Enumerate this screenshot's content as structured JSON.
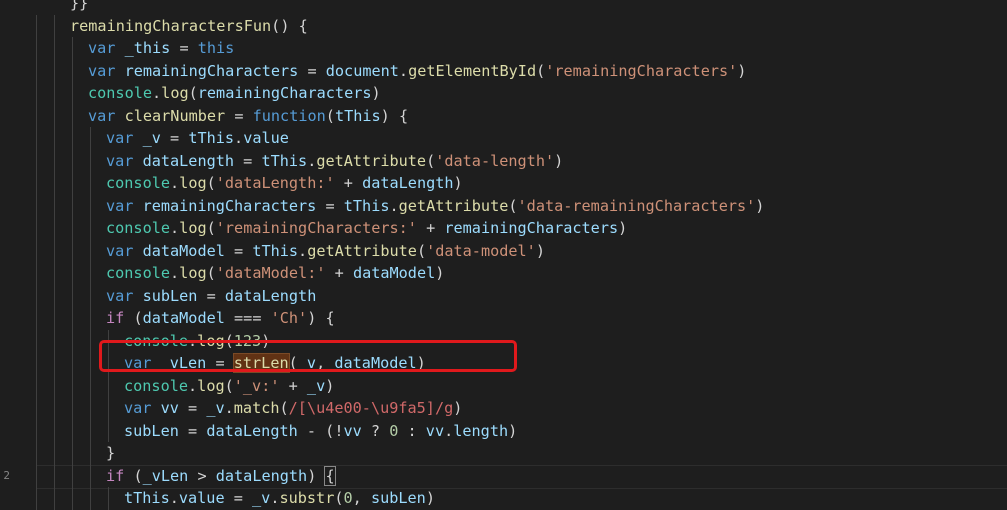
{
  "editor": {
    "line_numbers": [
      "",
      "",
      "",
      "",
      "",
      "",
      "",
      "",
      "",
      "",
      "",
      "",
      "",
      "",
      "",
      "",
      "",
      "",
      "",
      "",
      "",
      "2",
      ""
    ],
    "code_lines": [
      [
        {
          "t": "}}",
          "c": "pl"
        }
      ],
      [
        {
          "t": "remainingCharactersFun",
          "c": "fn"
        },
        {
          "t": "() {",
          "c": "pl"
        }
      ],
      [
        {
          "t": "var",
          "c": "kw"
        },
        {
          "t": " ",
          "c": "pl"
        },
        {
          "t": "_this",
          "c": "var"
        },
        {
          "t": " = ",
          "c": "pl"
        },
        {
          "t": "this",
          "c": "kw"
        }
      ],
      [
        {
          "t": "var",
          "c": "kw"
        },
        {
          "t": " ",
          "c": "pl"
        },
        {
          "t": "remainingCharacters",
          "c": "var"
        },
        {
          "t": " = ",
          "c": "pl"
        },
        {
          "t": "document",
          "c": "var"
        },
        {
          "t": ".",
          "c": "pl"
        },
        {
          "t": "getElementById",
          "c": "fn"
        },
        {
          "t": "(",
          "c": "pl"
        },
        {
          "t": "'remainingCharacters'",
          "c": "str"
        },
        {
          "t": ")",
          "c": "pl"
        }
      ],
      [
        {
          "t": "console",
          "c": "cls"
        },
        {
          "t": ".",
          "c": "pl"
        },
        {
          "t": "log",
          "c": "fn"
        },
        {
          "t": "(",
          "c": "pl"
        },
        {
          "t": "remainingCharacters",
          "c": "var"
        },
        {
          "t": ")",
          "c": "pl"
        }
      ],
      [
        {
          "t": "var",
          "c": "kw"
        },
        {
          "t": " ",
          "c": "pl"
        },
        {
          "t": "clearNumber",
          "c": "fn"
        },
        {
          "t": " = ",
          "c": "pl"
        },
        {
          "t": "function",
          "c": "kw"
        },
        {
          "t": "(",
          "c": "pl"
        },
        {
          "t": "tThis",
          "c": "var"
        },
        {
          "t": ") {",
          "c": "pl"
        }
      ],
      [
        {
          "t": "var",
          "c": "kw"
        },
        {
          "t": " ",
          "c": "pl"
        },
        {
          "t": "_v",
          "c": "var"
        },
        {
          "t": " = ",
          "c": "pl"
        },
        {
          "t": "tThis",
          "c": "var"
        },
        {
          "t": ".",
          "c": "pl"
        },
        {
          "t": "value",
          "c": "var"
        }
      ],
      [
        {
          "t": "var",
          "c": "kw"
        },
        {
          "t": " ",
          "c": "pl"
        },
        {
          "t": "dataLength",
          "c": "var"
        },
        {
          "t": " = ",
          "c": "pl"
        },
        {
          "t": "tThis",
          "c": "var"
        },
        {
          "t": ".",
          "c": "pl"
        },
        {
          "t": "getAttribute",
          "c": "fn"
        },
        {
          "t": "(",
          "c": "pl"
        },
        {
          "t": "'data-length'",
          "c": "str"
        },
        {
          "t": ")",
          "c": "pl"
        }
      ],
      [
        {
          "t": "console",
          "c": "cls"
        },
        {
          "t": ".",
          "c": "pl"
        },
        {
          "t": "log",
          "c": "fn"
        },
        {
          "t": "(",
          "c": "pl"
        },
        {
          "t": "'dataLength:'",
          "c": "str"
        },
        {
          "t": " + ",
          "c": "pl"
        },
        {
          "t": "dataLength",
          "c": "var"
        },
        {
          "t": ")",
          "c": "pl"
        }
      ],
      [
        {
          "t": "var",
          "c": "kw"
        },
        {
          "t": " ",
          "c": "pl"
        },
        {
          "t": "remainingCharacters",
          "c": "var"
        },
        {
          "t": " = ",
          "c": "pl"
        },
        {
          "t": "tThis",
          "c": "var"
        },
        {
          "t": ".",
          "c": "pl"
        },
        {
          "t": "getAttribute",
          "c": "fn"
        },
        {
          "t": "(",
          "c": "pl"
        },
        {
          "t": "'data-remainingCharacters'",
          "c": "str"
        },
        {
          "t": ")",
          "c": "pl"
        }
      ],
      [
        {
          "t": "console",
          "c": "cls"
        },
        {
          "t": ".",
          "c": "pl"
        },
        {
          "t": "log",
          "c": "fn"
        },
        {
          "t": "(",
          "c": "pl"
        },
        {
          "t": "'remainingCharacters:'",
          "c": "str"
        },
        {
          "t": " + ",
          "c": "pl"
        },
        {
          "t": "remainingCharacters",
          "c": "var"
        },
        {
          "t": ")",
          "c": "pl"
        }
      ],
      [
        {
          "t": "var",
          "c": "kw"
        },
        {
          "t": " ",
          "c": "pl"
        },
        {
          "t": "dataModel",
          "c": "var"
        },
        {
          "t": " = ",
          "c": "pl"
        },
        {
          "t": "tThis",
          "c": "var"
        },
        {
          "t": ".",
          "c": "pl"
        },
        {
          "t": "getAttribute",
          "c": "fn"
        },
        {
          "t": "(",
          "c": "pl"
        },
        {
          "t": "'data-model'",
          "c": "str"
        },
        {
          "t": ")",
          "c": "pl"
        }
      ],
      [
        {
          "t": "console",
          "c": "cls"
        },
        {
          "t": ".",
          "c": "pl"
        },
        {
          "t": "log",
          "c": "fn"
        },
        {
          "t": "(",
          "c": "pl"
        },
        {
          "t": "'dataModel:'",
          "c": "str"
        },
        {
          "t": " + ",
          "c": "pl"
        },
        {
          "t": "dataModel",
          "c": "var"
        },
        {
          "t": ")",
          "c": "pl"
        }
      ],
      [
        {
          "t": "var",
          "c": "kw"
        },
        {
          "t": " ",
          "c": "pl"
        },
        {
          "t": "subLen",
          "c": "var"
        },
        {
          "t": " = ",
          "c": "pl"
        },
        {
          "t": "dataLength",
          "c": "var"
        }
      ],
      [
        {
          "t": "if",
          "c": "kwc"
        },
        {
          "t": " (",
          "c": "pl"
        },
        {
          "t": "dataModel",
          "c": "var"
        },
        {
          "t": " === ",
          "c": "pl"
        },
        {
          "t": "'Ch'",
          "c": "str"
        },
        {
          "t": ") {",
          "c": "pl"
        }
      ],
      [
        {
          "t": "console",
          "c": "cls"
        },
        {
          "t": ".",
          "c": "pl"
        },
        {
          "t": "log",
          "c": "fn"
        },
        {
          "t": "(",
          "c": "pl"
        },
        {
          "t": "123",
          "c": "num"
        },
        {
          "t": ")",
          "c": "pl"
        }
      ],
      [
        {
          "t": "var",
          "c": "kw"
        },
        {
          "t": " ",
          "c": "pl"
        },
        {
          "t": "_vLen",
          "c": "var"
        },
        {
          "t": " = ",
          "c": "pl"
        },
        {
          "t": "strLen",
          "c": "fnhl"
        },
        {
          "t": "(",
          "c": "pl"
        },
        {
          "t": "_v",
          "c": "var"
        },
        {
          "t": ", ",
          "c": "pl"
        },
        {
          "t": "dataModel",
          "c": "var"
        },
        {
          "t": ")",
          "c": "pl"
        }
      ],
      [
        {
          "t": "console",
          "c": "cls"
        },
        {
          "t": ".",
          "c": "pl"
        },
        {
          "t": "log",
          "c": "fn"
        },
        {
          "t": "(",
          "c": "pl"
        },
        {
          "t": "'_v:'",
          "c": "str"
        },
        {
          "t": " + ",
          "c": "pl"
        },
        {
          "t": "_v",
          "c": "var"
        },
        {
          "t": ")",
          "c": "pl"
        }
      ],
      [
        {
          "t": "var",
          "c": "kw"
        },
        {
          "t": " ",
          "c": "pl"
        },
        {
          "t": "vv",
          "c": "var"
        },
        {
          "t": " = ",
          "c": "pl"
        },
        {
          "t": "_v",
          "c": "var"
        },
        {
          "t": ".",
          "c": "pl"
        },
        {
          "t": "match",
          "c": "fn"
        },
        {
          "t": "(",
          "c": "pl"
        },
        {
          "t": "/[\\u4e00-\\u9fa5]/g",
          "c": "rx"
        },
        {
          "t": ")",
          "c": "pl"
        }
      ],
      [
        {
          "t": "subLen",
          "c": "var"
        },
        {
          "t": " = ",
          "c": "pl"
        },
        {
          "t": "dataLength",
          "c": "var"
        },
        {
          "t": " - (!",
          "c": "pl"
        },
        {
          "t": "vv",
          "c": "var"
        },
        {
          "t": " ? ",
          "c": "pl"
        },
        {
          "t": "0",
          "c": "num"
        },
        {
          "t": " : ",
          "c": "pl"
        },
        {
          "t": "vv",
          "c": "var"
        },
        {
          "t": ".",
          "c": "pl"
        },
        {
          "t": "length",
          "c": "var"
        },
        {
          "t": ")",
          "c": "pl"
        }
      ],
      [
        {
          "t": "}",
          "c": "pl"
        }
      ],
      [
        {
          "t": "if",
          "c": "kwc"
        },
        {
          "t": " (",
          "c": "pl"
        },
        {
          "t": "_vLen",
          "c": "var"
        },
        {
          "t": " > ",
          "c": "pl"
        },
        {
          "t": "dataLength",
          "c": "var"
        },
        {
          "t": ") ",
          "c": "pl"
        },
        {
          "t": "{",
          "c": "bracehl"
        }
      ],
      [
        {
          "t": "tThis",
          "c": "var"
        },
        {
          "t": ".",
          "c": "pl"
        },
        {
          "t": "value",
          "c": "var"
        },
        {
          "t": " = ",
          "c": "pl"
        },
        {
          "t": "_v",
          "c": "var"
        },
        {
          "t": ".",
          "c": "pl"
        },
        {
          "t": "substr",
          "c": "fn"
        },
        {
          "t": "(",
          "c": "pl"
        },
        {
          "t": "0",
          "c": "num"
        },
        {
          "t": ", ",
          "c": "pl"
        },
        {
          "t": "subLen",
          "c": "var"
        },
        {
          "t": ")",
          "c": "pl"
        }
      ]
    ]
  },
  "annotation": {
    "color": "#e0191c",
    "description_target": "strLen call line"
  },
  "colors": {
    "background": "#1e1e1e",
    "keyword": "#569cd6",
    "function": "#dcdcaa",
    "variable": "#9cdcfe",
    "string": "#ce9178",
    "number": "#b5cea8",
    "class": "#4ec9b0",
    "regex": "#d16969",
    "control": "#c586c0"
  }
}
